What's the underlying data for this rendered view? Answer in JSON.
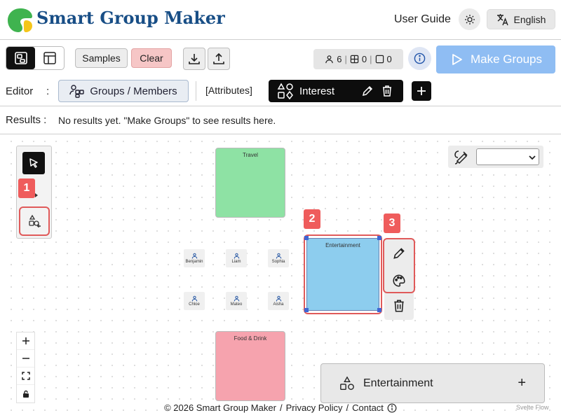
{
  "header": {
    "title": "Smart Group Maker",
    "user_guide": "User Guide",
    "language": "English",
    "logo_colors": {
      "green": "#3fb34f",
      "yellow": "#f4c51a"
    }
  },
  "toolbar": {
    "samples": "Samples",
    "clear": "Clear",
    "counts": {
      "members": "6",
      "groups": "0",
      "empty": "0"
    },
    "make_groups": "Make Groups"
  },
  "editor": {
    "label": "Editor",
    "colon": ":",
    "groups_members": "Groups / Members",
    "attributes": "[Attributes]",
    "interest": "Interest"
  },
  "results": {
    "label": "Results :",
    "message": "No results yet. \"Make Groups\" to see results here."
  },
  "canvas": {
    "badges": [
      "1",
      "2",
      "3"
    ],
    "groups": [
      {
        "name": "Travel",
        "color": "#8ee2a4"
      },
      {
        "name": "Entertainment",
        "color": "#8dcdee"
      },
      {
        "name": "Food & Drink",
        "color": "#f6a3ae"
      }
    ],
    "members": [
      "Benjamin",
      "Liam",
      "Sophia",
      "Chloe",
      "Mateo",
      "Aisha"
    ],
    "style_select_value": ""
  },
  "detail": {
    "name": "Entertainment",
    "add": "+"
  },
  "footer": {
    "copyright": "© 2026 Smart Group Maker",
    "sep1": "/",
    "privacy": "Privacy Policy",
    "sep2": "/",
    "contact": "Contact",
    "attribution": "Svelte Flow"
  }
}
